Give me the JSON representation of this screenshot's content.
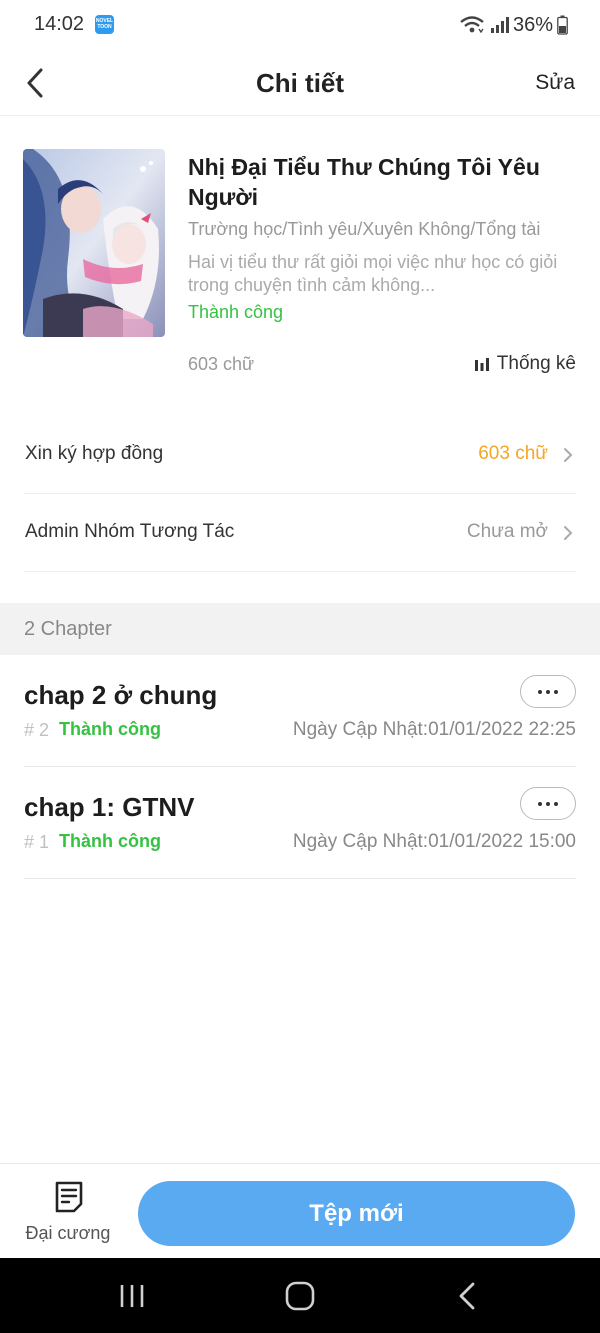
{
  "status_bar": {
    "time": "14:02",
    "app_icon_text": "NOVEL TOON",
    "battery": "36%"
  },
  "header": {
    "title": "Chi tiết",
    "edit_label": "Sửa"
  },
  "book": {
    "title": "Nhị Đại Tiểu Thư Chúng Tôi Yêu Người",
    "genres": "Trường học/Tình yêu/Xuyên Không/Tổng tài",
    "description": "Hai vị tiểu thư rất giỏi mọi việc như học có giỏi trong chuyện tình cảm không...",
    "status": "Thành công",
    "word_count": "603 chữ",
    "stats_label": "Thống kê"
  },
  "settings": [
    {
      "label": "Xin ký hợp đồng",
      "value": "603 chữ",
      "value_color": "#f5a623"
    },
    {
      "label": "Admin Nhóm Tương Tác",
      "value": "Chưa mở",
      "value_color": "#999999"
    }
  ],
  "chapters_header": "2 Chapter",
  "chapters": [
    {
      "title": "chap 2 ở chung",
      "number": "# 2",
      "status": "Thành công",
      "date": "Ngày Cập Nhật:01/01/2022 22:25"
    },
    {
      "title": "chap 1: GTNV",
      "number": "# 1",
      "status": "Thành công",
      "date": "Ngày Cập Nhật:01/01/2022 15:00"
    }
  ],
  "bottom": {
    "outline_label": "Đại cương",
    "new_file_label": "Tệp mới"
  },
  "colors": {
    "accent_blue": "#5aaaf2",
    "success_green": "#35c242",
    "orange": "#f5a623"
  }
}
